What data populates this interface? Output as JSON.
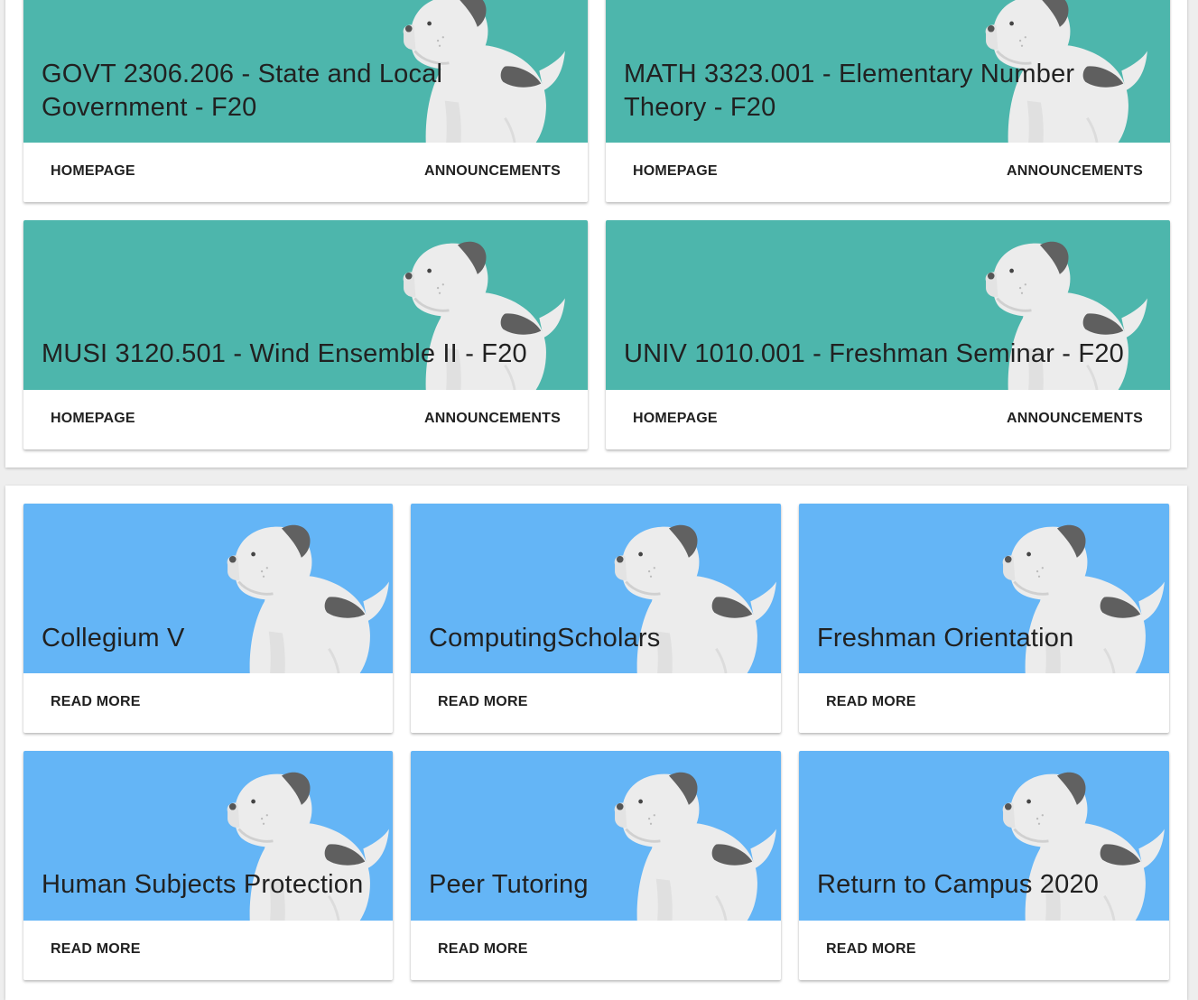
{
  "courses": [
    {
      "title": "GOVT 2306.206 - State and Local Government - F20",
      "homepage": "HOMEPAGE",
      "announcements": "ANNOUNCEMENTS"
    },
    {
      "title": "MATH 3323.001 - Elementary Number Theory - F20",
      "homepage": "HOMEPAGE",
      "announcements": "ANNOUNCEMENTS"
    },
    {
      "title": "MUSI 3120.501 - Wind Ensemble II - F20",
      "homepage": "HOMEPAGE",
      "announcements": "ANNOUNCEMENTS"
    },
    {
      "title": "UNIV 1010.001 - Freshman Seminar - F20",
      "homepage": "HOMEPAGE",
      "announcements": "ANNOUNCEMENTS"
    }
  ],
  "organizations": [
    {
      "title": "Collegium V",
      "read_more": "READ MORE"
    },
    {
      "title": "ComputingScholars",
      "read_more": "READ MORE"
    },
    {
      "title": "Freshman Orientation",
      "read_more": "READ MORE"
    },
    {
      "title": "Human Subjects Protection",
      "read_more": "READ MORE"
    },
    {
      "title": "Peer Tutoring",
      "read_more": "READ MORE"
    },
    {
      "title": "Return to Campus 2020",
      "read_more": "READ MORE"
    }
  ],
  "colors": {
    "course_banner": "#4db6ac",
    "organization_banner": "#64b5f6",
    "card_background": "#ffffff",
    "page_background": "#eeeeee"
  },
  "icons": {
    "card_illustration": "bulldog-mascot-illustration"
  }
}
